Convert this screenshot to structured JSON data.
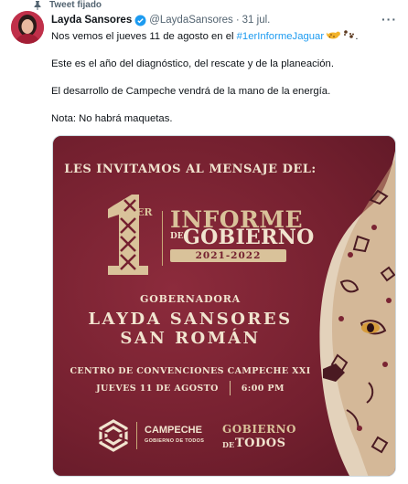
{
  "pinned_label": "Tweet fijado",
  "user": {
    "name": "Layda Sansores",
    "handle": "@LaydaSansores",
    "separator": "·",
    "date": "31 jul."
  },
  "more_label": "···",
  "tweet": {
    "line1_before": "Nos vemos el jueves 11 de agosto en el ",
    "hashtag": "#1erInformeJaguar",
    "line2": "Este es el año del diagnóstico, del rescate y de la planeación.",
    "line3": "El desarrollo de Campeche vendrá de la mano de la energía.",
    "line4": "Nota: No habrá maquetas."
  },
  "poster": {
    "invite": "LES INVITAMOS  AL MENSAJE DEL:",
    "ordinal_suffix": "ER",
    "informe": "INFORME",
    "de": "DE",
    "gobierno": "GOBIERNO",
    "years": "2021-2022",
    "gobernadora": "GOBERNADORA",
    "name_line1": "LAYDA SANSORES",
    "name_line2": "SAN ROMÁN",
    "venue": "CENTRO DE CONVENCIONES CAMPECHE XXI",
    "date": "JUEVES 11 DE AGOSTO",
    "time": "6:00 PM",
    "campeche": "CAMPECHE",
    "campeche_sub": "GOBIERNO DE TODOS",
    "gobierno_logo": "GOBIERNO",
    "de_logo": "DE",
    "todos_logo": "TODOS"
  },
  "colors": {
    "maroon": "#74202f",
    "gold": "#d9c29a",
    "cream": "#f1e4cf",
    "link": "#1d9bf0",
    "verified": "#1d9bf0"
  },
  "icons": [
    "pin-icon",
    "verified-badge-icon",
    "jaguar-emoji-icon",
    "paw-prints-emoji-icon",
    "more-icon",
    "campeche-logo-icon"
  ]
}
